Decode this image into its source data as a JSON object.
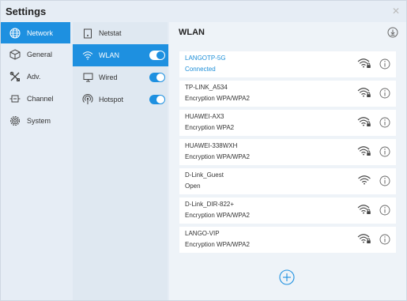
{
  "window": {
    "title": "Settings",
    "close_icon": "close-icon"
  },
  "nav": {
    "items": [
      {
        "label": "Network",
        "icon": "globe-icon",
        "active": true
      },
      {
        "label": "General",
        "icon": "cube-icon",
        "active": false
      },
      {
        "label": "Adv.",
        "icon": "tools-icon",
        "active": false
      },
      {
        "label": "Channel",
        "icon": "channel-icon",
        "active": false
      },
      {
        "label": "System",
        "icon": "gear-icon",
        "active": false
      }
    ]
  },
  "sub_nav": {
    "items": [
      {
        "label": "Netstat",
        "icon": "netstat-icon",
        "toggle": false
      },
      {
        "label": "WLAN",
        "icon": "wifi-icon",
        "toggle": true,
        "active": true
      },
      {
        "label": "Wired",
        "icon": "monitor-icon",
        "toggle": true
      },
      {
        "label": "Hotspot",
        "icon": "hotspot-icon",
        "toggle": true
      }
    ]
  },
  "wlan": {
    "title": "WLAN",
    "networks": [
      {
        "ssid": "LANGOTP-5G",
        "status": "Connected",
        "connected": true
      },
      {
        "ssid": "TP-LINK_A534",
        "status": "Encryption WPA/WPA2",
        "connected": false
      },
      {
        "ssid": "HUAWEI-AX3",
        "status": "Encryption WPA2",
        "connected": false
      },
      {
        "ssid": "HUAWEI-338WXH",
        "status": "Encryption WPA/WPA2",
        "connected": false
      },
      {
        "ssid": "D-Link_Guest",
        "status": "Open",
        "connected": false
      },
      {
        "ssid": "D-Link_DIR-822+",
        "status": "Encryption WPA/WPA2",
        "connected": false
      },
      {
        "ssid": "LANGO-VIP",
        "status": "Encryption WPA/WPA2",
        "connected": false
      }
    ]
  },
  "colors": {
    "accent": "#1e90e0",
    "connected_text": "#1e8fd8"
  }
}
